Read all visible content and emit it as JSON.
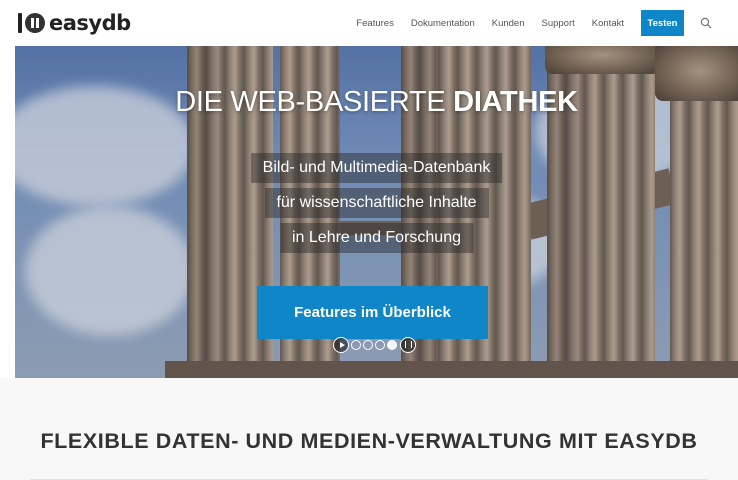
{
  "brand": {
    "name": "easydb"
  },
  "nav": {
    "items": [
      "Features",
      "Dokumentation",
      "Kunden",
      "Support",
      "Kontakt"
    ],
    "cta": "Testen",
    "search_icon": "search-icon"
  },
  "hero": {
    "title_light": "DIE WEB-BASIERTE ",
    "title_bold": "DIATHEK",
    "subtitle_lines": [
      "Bild- und Multimedia-Datenbank",
      "für wissenschaftliche Inhalte",
      "in Lehre und Forschung"
    ],
    "button": "Features im Überblick",
    "slider": {
      "slide_count": 4,
      "active_index": 3
    }
  },
  "section": {
    "title": "FLEXIBLE DATEN- UND MEDIEN-VERWALTUNG MIT EASYDB"
  },
  "colors": {
    "accent": "#0e86c7",
    "text": "#333333",
    "section_bg": "#f8f8f8"
  }
}
